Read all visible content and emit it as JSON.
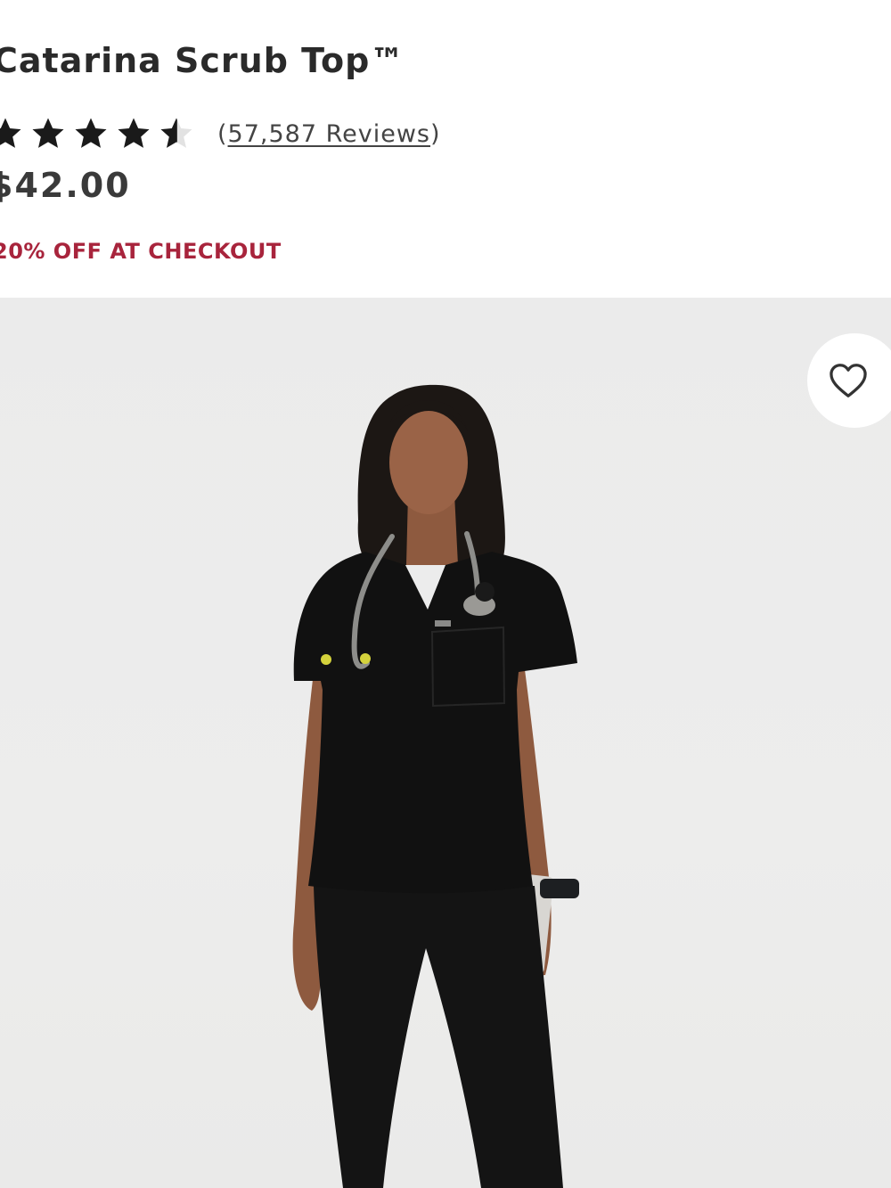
{
  "product": {
    "title": "Catarina Scrub Top™",
    "rating": 4.5,
    "rating_max": 5,
    "reviews_open": "(",
    "reviews_link": "57,587 Reviews",
    "reviews_close": ")",
    "price": "$42.00",
    "promo": "20% OFF AT CHECKOUT"
  },
  "icons": {
    "star": "star-icon",
    "favorite": "heart-outline-icon"
  },
  "colors": {
    "promo": "#a8243c",
    "text": "#222222",
    "hero_background": "#ebebeb",
    "scrubs": "#111111"
  }
}
